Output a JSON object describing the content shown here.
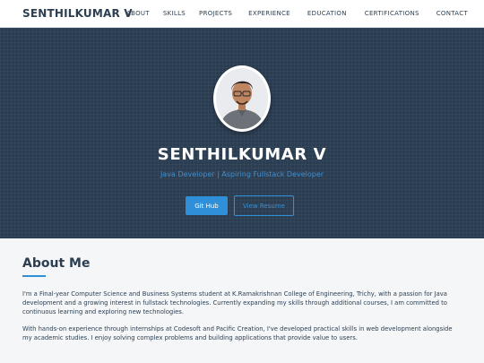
{
  "nav": {
    "brand": "SENTHILKUMAR V",
    "links": [
      "ABOUT",
      "SKILLS",
      "PROJECTS",
      "EXPERIENCE",
      "EDUCATION",
      "CERTIFICATIONS",
      "CONTACT"
    ]
  },
  "hero": {
    "name": "SENTHILKUMAR V",
    "subtitle": "Java Developer | Aspiring Fullstack Developer",
    "github_label": "Git Hub",
    "resume_label": "View Resume"
  },
  "about": {
    "title": "About Me",
    "paragraphs": [
      "I'm a Final-year Computer Science and Business Systems student at K.Ramakrishnan College of Engineering, Trichy, with a passion for Java development and a growing interest in fullstack technologies. Currently expanding my skills through additional courses, I am committed to continuous learning and exploring new technologies.",
      "With hands-on experience through internships at Codesoft and Pacific Creation, I've developed practical skills in web development alongside my academic studies. I enjoy solving complex problems and building applications that provide value to users."
    ]
  },
  "colors": {
    "hero_bg": "#2b3d52",
    "accent": "#2f8fd8",
    "text": "#2c3e50"
  }
}
